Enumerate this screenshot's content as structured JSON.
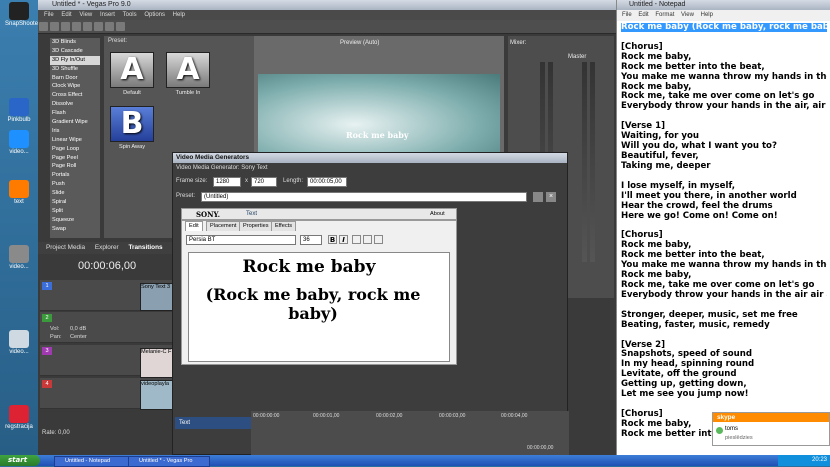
{
  "desktop": {
    "icons": [
      {
        "label": "SnapShooter"
      },
      {
        "label": "Pinkbulb"
      },
      {
        "label": "video..."
      },
      {
        "label": "text"
      },
      {
        "label": "video..."
      },
      {
        "label": "video..."
      },
      {
        "label": "regstracija"
      }
    ]
  },
  "vegas": {
    "title": "Untitled * - Vegas Pro 9.0",
    "menu": [
      "File",
      "Edit",
      "View",
      "Insert",
      "Tools",
      "Options",
      "Help"
    ],
    "fx_list": [
      "3D Blinds",
      "3D Cascade",
      "3D Fly In/Out",
      "3D Shuffle",
      "Barn Door",
      "Clock Wipe",
      "Cross Effect",
      "Dissolve",
      "Flash",
      "Gradient Wipe",
      "Iris",
      "Linear Wipe",
      "Page Loop",
      "Page Peel",
      "Page Roll",
      "Portals",
      "Push",
      "Slide",
      "Spiral",
      "Split",
      "Squeeze",
      "Swap"
    ],
    "fx_selected": "3D Fly In/Out",
    "preset_label": "Preset:",
    "presets": [
      {
        "glyph": "A",
        "label": "Default"
      },
      {
        "glyph": "A",
        "label": "Tumble In"
      },
      {
        "glyph": "B",
        "label": "Spin Away"
      }
    ],
    "preview_mode": "Preview (Auto)",
    "preview_text": "Rock me baby",
    "mixer_label": "Mixer:",
    "master_label": "Master",
    "tabs": [
      "Project Media",
      "Explorer",
      "Transitions"
    ],
    "active_tab": "Transitions",
    "timecode": "00:00:06,00",
    "track_vol_label": "Vol:",
    "track_vol_value": "0,0 dB",
    "track_pan_label": "Pan:",
    "track_pan_value": "Center",
    "clips": [
      "Sony Text 3",
      "Melanie-C F",
      "videoplayla"
    ],
    "rate": "Rate: 0,00"
  },
  "dialog": {
    "title": "Video Media Generators",
    "subtitle": "Video Media Generator: Sony Text",
    "frame_size_label": "Frame size:",
    "frame_w": "1280",
    "x": "x",
    "frame_h": "720",
    "length_label": "Length:",
    "length_value": "00:00:05,00",
    "preset_label": "Preset:",
    "preset_value": "(Untitled)",
    "brand": "SONY.",
    "plugin": "Text",
    "about": "About",
    "tabs": [
      "Edit",
      "Placement",
      "Properties",
      "Effects"
    ],
    "font_name": "Persia BT",
    "font_size": "36",
    "text_line1": "Rock me baby",
    "text_line2": "(Rock me baby, rock me baby)",
    "timeline_track": "Text",
    "ruler": [
      "00:00:00:00",
      "00:00:01,00",
      "00:00:02,00",
      "00:00:03,00",
      "00:00:04,00"
    ],
    "bottom_time": "00:00:00,00"
  },
  "notepad": {
    "title": "Untitled - Notepad",
    "menu": [
      "File",
      "Edit",
      "Format",
      "View",
      "Help"
    ],
    "lines": [
      "Rock me baby (Rock me baby, rock me baby)",
      "",
      "[Chorus]",
      "Rock me baby,",
      "Rock me better into the beat,",
      "You make me wanna throw my hands in the air, al",
      "Rock me baby,",
      "Rock me, take me over come on let's go",
      "Everybody throw your hands in the air, air",
      "",
      "[Verse 1]",
      "Waiting, for you",
      "Will you do, what I want you to?",
      "Beautiful, fever,",
      "Taking me, deeper",
      "",
      "I lose myself, in myself,",
      "I'll meet you there, in another world",
      "Hear the crowd, feel the drums",
      "Here we go! Come on! Come on!",
      "",
      "[Chorus]",
      "Rock me baby,",
      "Rock me better into the beat,",
      "You make me wanna throw my hands in the air, al",
      "Rock me baby,",
      "Rock me, take me over come on let's go",
      "Everybody throw your hands in the air air air",
      "",
      "Stronger, deeper, music, set me free",
      "Beating, faster, music, remedy",
      "",
      "[Verse 2]",
      "Snapshots, speed of sound",
      "In my head, spinning round",
      "Levitate, off the ground",
      "Getting up, getting down,",
      "Let me see you jump now!",
      "",
      "[Chorus]",
      "Rock me baby,",
      "Rock me better into the"
    ]
  },
  "skype": {
    "header": "skype",
    "user": "toms",
    "status": "pieslēdzies"
  },
  "taskbar": {
    "start": "start",
    "tasks": [
      "Untitled - Notepad",
      "Untitled * - Vegas Pro"
    ],
    "clock": "20:23"
  }
}
